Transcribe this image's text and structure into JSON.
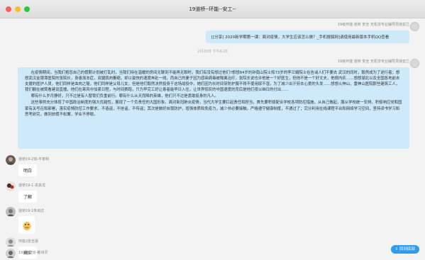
{
  "window": {
    "title": "19道桥--环能--安工--"
  },
  "messages": {
    "share_sender": "19级环能 道桥 安全 无机非专业辅导员徐亚兰",
    "share_text": "[[分享] 2020新学期第一课：面对疫情，大学生应该怎么做？_手机搜狐网]请使用最新版本手机QQ查看",
    "timestamp": "2月20日 下午6:20",
    "article_sender": "19级环能 道桥 安全 无机非专业辅导员徐亚兰",
    "article": {
      "p1": "在疫情期间，当我们抱怨自己的假期计划被打乱时，当我们待在温暖的房间无聊到不能再无聊时，我们有没有想过他们?想想84岁的钟南山院士和73岁的李兰娟院士在告诫人们不要去 武汉的同时，毅然成为了逆行者；想想武汉金银潭医院的张院长，身患渐冻症，双腿肌肉萎缩，却以最快的速度奔赴一线，而自己的妻子因为感染病毒被隔离治疗，张院长说也许他是一个好医生，但他不是一个好丈夫，他很内疚……想想湖北以及全国各地前去支援的医护人员，他们同样是血肉之躯，他们同样是父母儿女，但是他们毅然决然投身于这场战役中，她们因为长时间穿防护服不得不使用尿不湿，为了减少出汗剪去心爱的头发……想想火神山，雷神山医院那些建筑工人，我们躺在被窝看建设直播，他们在寒风中加紧日程，与时间赛跑，只为早完工好让患者能早日入住，让世界惊叹的中国速度的背后是他们夜以继日的付出……",
      "p2": "哪有什么岁月静好，只不过是有人替我们负重前行。哪有什么从天而降的英雄，他们只不过是勇敢挺身的凡人。",
      "p3": "这些事例充分体现了中国政治制度的强大优越性，展现了一个负责任的大国形象。面对新冠肺炎疫情，当代大学生要扛起责任和担当，首先要积极配合学校各项防控措施，从自己做起，服从学校统一安排，积极响应党和国家有关号召和部署，落实疫情防控工作要求，不造谣，不信谣，不传谣；其次是做好自我防护，增强体质和免疫力，减少非必要接触，严格遵守健康制度，不通过了；完分利用在线课程平台和网络学习空间，坚持读书学习和思考研究，做到放假不松懈，学业不停歇。"
    },
    "replies": [
      {
        "sender": "道桥19-2班-平家和",
        "text": "明白"
      },
      {
        "sender": "道桥19-1-袁其龙",
        "text": "了解"
      },
      {
        "sender": "道桥19-2朱启达",
        "sticker": "sticker-emoji"
      },
      {
        "sender": "环能2张吉豪",
        "text": "确实"
      },
      {
        "sender": "19道桥2班-戴诗灵"
      }
    ]
  },
  "back_button": "回到底部",
  "colors": {
    "bubble_self": "#cde9fa",
    "bubble_other": "#ffffff",
    "accent": "#2d9cf0"
  }
}
